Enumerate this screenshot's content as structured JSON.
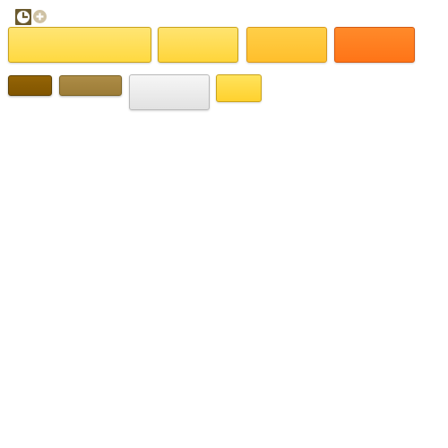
{
  "icons": {
    "clock": "clock-icon",
    "add": "plus-circle-icon"
  },
  "swatches": [
    {
      "name": "swatch-yellow-wide",
      "label": "",
      "color": "#ffdf5a"
    },
    {
      "name": "swatch-yellow",
      "label": "",
      "color": "#ffdc55"
    },
    {
      "name": "swatch-amber",
      "label": "",
      "color": "#ffc73a"
    },
    {
      "name": "swatch-orange",
      "label": "",
      "color": "#ff7f20"
    },
    {
      "name": "swatch-dark-brown",
      "label": "",
      "color": "#8b5c03"
    },
    {
      "name": "swatch-light-brown",
      "label": "",
      "color": "#a5843e"
    },
    {
      "name": "swatch-light-gray",
      "label": "",
      "color": "#ececec"
    },
    {
      "name": "swatch-yellow-small",
      "label": "",
      "color": "#ffda45"
    }
  ]
}
